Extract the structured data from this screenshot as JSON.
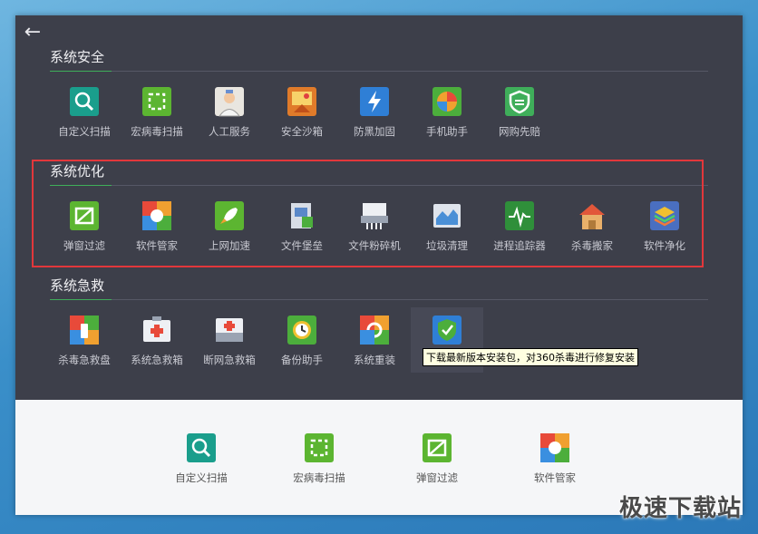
{
  "back_label": "←",
  "sections": [
    {
      "title": "系统安全",
      "items": [
        {
          "label": "自定义扫描",
          "icon": "custom-scan-icon"
        },
        {
          "label": "宏病毒扫描",
          "icon": "macro-virus-scan-icon"
        },
        {
          "label": "人工服务",
          "icon": "manual-service-icon"
        },
        {
          "label": "安全沙箱",
          "icon": "sandbox-icon"
        },
        {
          "label": "防黑加固",
          "icon": "anti-hack-icon"
        },
        {
          "label": "手机助手",
          "icon": "phone-assistant-icon"
        },
        {
          "label": "网购先赔",
          "icon": "shopping-shield-icon"
        }
      ]
    },
    {
      "title": "系统优化",
      "items": [
        {
          "label": "弹窗过滤",
          "icon": "popup-filter-icon"
        },
        {
          "label": "软件管家",
          "icon": "software-manager-icon"
        },
        {
          "label": "上网加速",
          "icon": "net-accelerate-icon"
        },
        {
          "label": "文件堡垒",
          "icon": "file-fortress-icon"
        },
        {
          "label": "文件粉碎机",
          "icon": "file-shredder-icon"
        },
        {
          "label": "垃圾清理",
          "icon": "junk-clean-icon"
        },
        {
          "label": "进程追踪器",
          "icon": "process-tracker-icon"
        },
        {
          "label": "杀毒搬家",
          "icon": "antivirus-move-icon"
        },
        {
          "label": "软件净化",
          "icon": "software-purify-icon"
        }
      ]
    },
    {
      "title": "系统急救",
      "items": [
        {
          "label": "杀毒急救盘",
          "icon": "rescue-disk-icon"
        },
        {
          "label": "系统急救箱",
          "icon": "system-rescue-kit-icon"
        },
        {
          "label": "断网急救箱",
          "icon": "network-rescue-kit-icon"
        },
        {
          "label": "备份助手",
          "icon": "backup-assistant-icon"
        },
        {
          "label": "系统重装",
          "icon": "system-reinstall-icon"
        },
        {
          "label": "",
          "icon": "repair-install-icon"
        }
      ]
    }
  ],
  "tooltip": "下载最新版本安装包，对360杀毒进行修复安装",
  "bottom_items": [
    {
      "label": "自定义扫描",
      "icon": "custom-scan-icon"
    },
    {
      "label": "宏病毒扫描",
      "icon": "macro-virus-scan-icon"
    },
    {
      "label": "弹窗过滤",
      "icon": "popup-filter-icon"
    },
    {
      "label": "软件管家",
      "icon": "software-manager-icon"
    }
  ],
  "watermark": "极速下载站"
}
